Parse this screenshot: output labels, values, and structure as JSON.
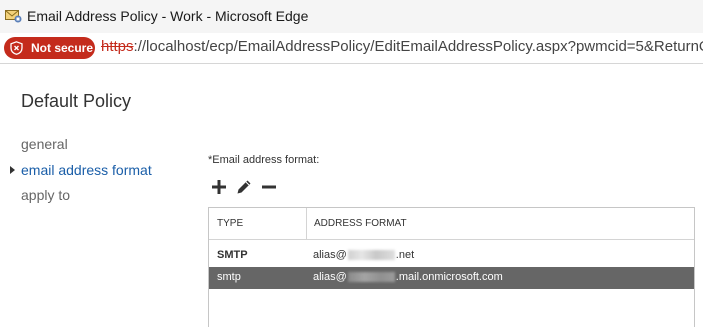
{
  "window": {
    "title": "Email Address Policy - Work - Microsoft Edge",
    "app_icon": "envelope-policy-icon"
  },
  "addressbar": {
    "security_label": "Not secure",
    "security_icon": "shield-warning-icon",
    "url_scheme": "https",
    "url_rest": "://localhost/ecp/EmailAddressPolicy/EditEmailAddressPolicy.aspx?pwmcid=5&ReturnObjectTy"
  },
  "page": {
    "title": "Default Policy"
  },
  "nav": {
    "items": [
      {
        "label": "general",
        "selected": false
      },
      {
        "label": "email address format",
        "selected": true
      },
      {
        "label": "apply to",
        "selected": false
      }
    ]
  },
  "form": {
    "field_label": "*Email address format:",
    "toolbar": {
      "add_icon": "plus-icon",
      "edit_icon": "pencil-icon",
      "remove_icon": "minus-icon"
    }
  },
  "grid": {
    "columns": [
      "TYPE",
      "ADDRESS FORMAT"
    ],
    "rows": [
      {
        "type": "SMTP",
        "addr_prefix": "alias@",
        "addr_suffix": ".net",
        "selected": false
      },
      {
        "type": "smtp",
        "addr_prefix": "alias@",
        "addr_suffix": ".mail.onmicrosoft.com",
        "selected": true
      }
    ]
  },
  "colors": {
    "not_secure_badge": "#c42b1c",
    "nav_selected": "#1a5ea8",
    "row_selected": "#666666"
  }
}
